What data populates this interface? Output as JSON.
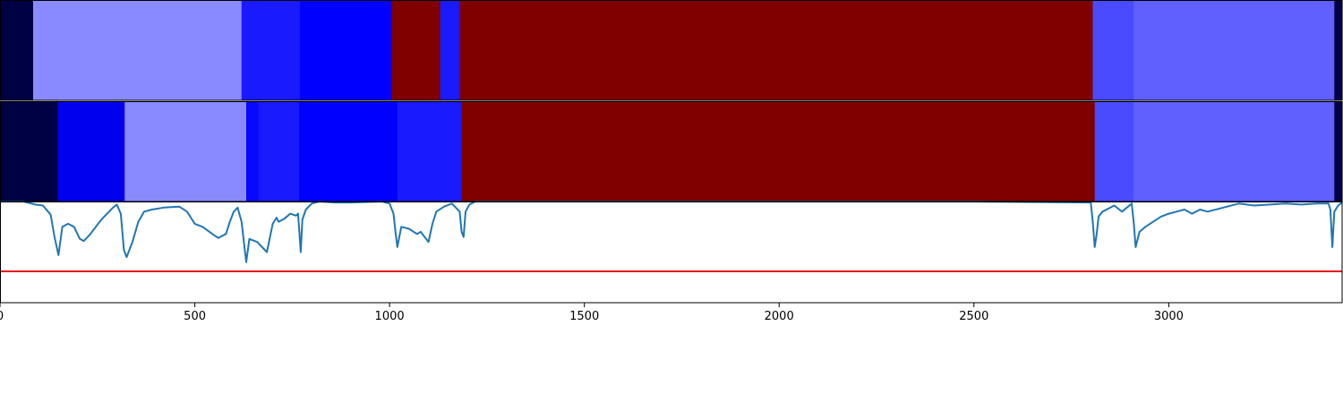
{
  "chart_data": [
    {
      "type": "heatmap",
      "title": "",
      "x_range": [
        0,
        3445
      ],
      "segments": [
        {
          "x0": 0,
          "x1": 85,
          "color": "#000044"
        },
        {
          "x0": 85,
          "x1": 620,
          "color": "#8a8aff"
        },
        {
          "x0": 620,
          "x1": 770,
          "color": "#1a1aff"
        },
        {
          "x0": 770,
          "x1": 1005,
          "color": "#0000ff"
        },
        {
          "x0": 1005,
          "x1": 1130,
          "color": "#800000"
        },
        {
          "x0": 1130,
          "x1": 1180,
          "color": "#1a1aff"
        },
        {
          "x0": 1180,
          "x1": 2805,
          "color": "#800000"
        },
        {
          "x0": 2805,
          "x1": 2910,
          "color": "#4a4aff"
        },
        {
          "x0": 2910,
          "x1": 3425,
          "color": "#6060ff"
        },
        {
          "x0": 3425,
          "x1": 3445,
          "color": "#000044"
        }
      ]
    },
    {
      "type": "heatmap",
      "title": "",
      "x_range": [
        0,
        3445
      ],
      "segments": [
        {
          "x0": 0,
          "x1": 148,
          "color": "#000044"
        },
        {
          "x0": 148,
          "x1": 320,
          "color": "#0000ee"
        },
        {
          "x0": 320,
          "x1": 632,
          "color": "#8a8aff"
        },
        {
          "x0": 632,
          "x1": 663,
          "color": "#0808ff"
        },
        {
          "x0": 663,
          "x1": 768,
          "color": "#1a1aff"
        },
        {
          "x0": 768,
          "x1": 1020,
          "color": "#0000ff"
        },
        {
          "x0": 1020,
          "x1": 1185,
          "color": "#1a1aff"
        },
        {
          "x0": 1185,
          "x1": 2810,
          "color": "#800000"
        },
        {
          "x0": 2810,
          "x1": 2910,
          "color": "#4a4aff"
        },
        {
          "x0": 2910,
          "x1": 3425,
          "color": "#6060ff"
        },
        {
          "x0": 3425,
          "x1": 3445,
          "color": "#000044"
        }
      ]
    },
    {
      "type": "line",
      "title": "",
      "xlabel": "",
      "ylabel": "",
      "xlim": [
        0,
        3445
      ],
      "ylim": [
        -1.0,
        0.0
      ],
      "xticks": [
        0,
        500,
        1000,
        1500,
        2000,
        2500,
        3000
      ],
      "xtick_labels": [
        "0",
        "500",
        "1000",
        "1500",
        "2000",
        "2500",
        "3000"
      ],
      "series": [
        {
          "color": "#1f77b4",
          "x": [
            0,
            60,
            90,
            110,
            130,
            140,
            150,
            160,
            175,
            190,
            205,
            215,
            230,
            260,
            290,
            300,
            310,
            318,
            325,
            340,
            355,
            370,
            390,
            420,
            460,
            480,
            490,
            500,
            520,
            545,
            560,
            565,
            580,
            590,
            600,
            610,
            620,
            632,
            640,
            660,
            685,
            700,
            710,
            715,
            730,
            745,
            760,
            765,
            772,
            776,
            785,
            800,
            820,
            860,
            900,
            980,
            1000,
            1010,
            1015,
            1020,
            1030,
            1050,
            1070,
            1080,
            1090,
            1100,
            1110,
            1120,
            1140,
            1160,
            1180,
            1185,
            1190,
            1195,
            1205,
            1220,
            1260,
            1600,
            2000,
            2500,
            2800,
            2805,
            2810,
            2815,
            2820,
            2830,
            2860,
            2880,
            2905,
            2910,
            2915,
            2925,
            2940,
            2960,
            2980,
            3000,
            3020,
            3040,
            3060,
            3080,
            3100,
            3140,
            3180,
            3220,
            3260,
            3300,
            3340,
            3380,
            3410,
            3415,
            3420,
            3425,
            3435,
            3445
          ],
          "y": [
            0.0,
            0.0,
            -0.03,
            -0.04,
            -0.13,
            -0.35,
            -0.53,
            -0.25,
            -0.22,
            -0.25,
            -0.37,
            -0.39,
            -0.33,
            -0.18,
            -0.06,
            -0.03,
            -0.12,
            -0.48,
            -0.55,
            -0.4,
            -0.2,
            -0.1,
            -0.08,
            -0.06,
            -0.05,
            -0.1,
            -0.16,
            -0.22,
            -0.25,
            -0.32,
            -0.36,
            -0.35,
            -0.32,
            -0.2,
            -0.1,
            -0.06,
            -0.2,
            -0.6,
            -0.37,
            -0.4,
            -0.5,
            -0.22,
            -0.16,
            -0.2,
            -0.17,
            -0.12,
            -0.14,
            -0.12,
            -0.5,
            -0.18,
            -0.08,
            -0.02,
            0.0,
            -0.01,
            -0.01,
            0.0,
            -0.02,
            -0.12,
            -0.3,
            -0.45,
            -0.25,
            -0.27,
            -0.32,
            -0.3,
            -0.35,
            -0.4,
            -0.22,
            -0.1,
            -0.05,
            -0.02,
            -0.1,
            -0.3,
            -0.35,
            -0.1,
            -0.03,
            0.0,
            0.0,
            0.0,
            0.0,
            0.0,
            -0.01,
            -0.2,
            -0.45,
            -0.32,
            -0.15,
            -0.1,
            -0.04,
            -0.1,
            -0.02,
            -0.2,
            -0.45,
            -0.3,
            -0.25,
            -0.2,
            -0.15,
            -0.12,
            -0.1,
            -0.08,
            -0.12,
            -0.08,
            -0.1,
            -0.06,
            -0.02,
            -0.04,
            -0.03,
            -0.02,
            -0.03,
            -0.02,
            -0.02,
            -0.08,
            -0.45,
            -0.1,
            -0.04,
            -0.01
          ]
        }
      ],
      "reference_lines": [
        {
          "type": "horizontal",
          "y": -0.69,
          "color": "#e8191d"
        }
      ]
    }
  ]
}
